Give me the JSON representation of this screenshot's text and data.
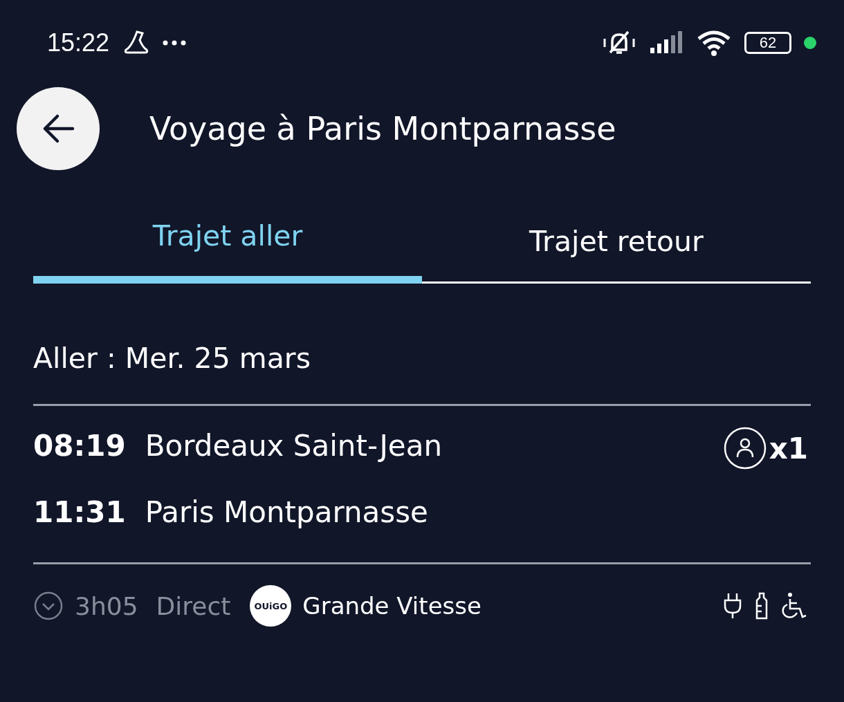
{
  "status_bar": {
    "time": "15:22",
    "battery": "62"
  },
  "header": {
    "title": "Voyage à Paris Montparnasse"
  },
  "tabs": [
    {
      "label": "Trajet aller",
      "selected": true
    },
    {
      "label": "Trajet retour",
      "selected": false
    }
  ],
  "date": "Aller : Mer. 25 mars",
  "stops": [
    {
      "time": "08:19",
      "station": "Bordeaux Saint-Jean"
    },
    {
      "time": "11:31",
      "station": "Paris Montparnasse"
    }
  ],
  "passengers": "x1",
  "footer": {
    "duration": "3h05",
    "type": "Direct",
    "operator_logo": "OUiGO",
    "service": "Grande Vitesse"
  }
}
